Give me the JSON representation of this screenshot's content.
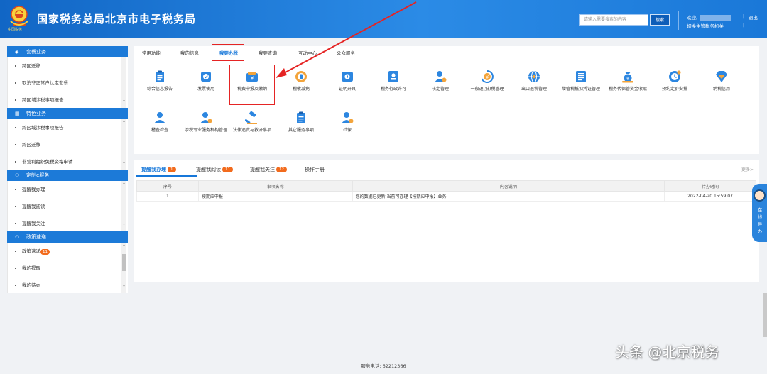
{
  "header": {
    "title": "国家税务总局北京市电子税务局",
    "emblem_caption": "中国税务",
    "search_placeholder": "请输入需要搜索的内容",
    "search_button": "搜索",
    "welcome": "欢迎,",
    "switch_label": "切换主管税务机关",
    "logout": "退出",
    "separator": "|"
  },
  "sidebar": {
    "groups": [
      {
        "title": "套餐业务",
        "icon": "layers-icon",
        "items": [
          "跨区迁移",
          "取消非正常户认定套餐",
          "跨区域涉税事项报告"
        ]
      },
      {
        "title": "特色业务",
        "icon": "grid-icon",
        "items": [
          "跨区域涉税事项报告",
          "跨区迁移",
          "非营利组织免税资格申请"
        ]
      },
      {
        "title": "定制e服务",
        "icon": "user-icon",
        "items": [
          "提醒我办理",
          "提醒我阅读",
          "提醒我关注"
        ]
      },
      {
        "title": "政策速递",
        "icon": "user-icon",
        "items": [
          "政策速递",
          "我的提醒",
          "我的待办"
        ],
        "badge": "11"
      }
    ]
  },
  "top_tabs": [
    "常用功能",
    "我的信息",
    "我要办税",
    "我要查询",
    "互动中心",
    "公众服务"
  ],
  "active_top_tab": "我要办税",
  "functions_row1": [
    {
      "label": "综合信息报告",
      "icon": "clipboard-icon"
    },
    {
      "label": "发票使用",
      "icon": "invoice-icon"
    },
    {
      "label": "税费申报及缴纳",
      "icon": "wallet-yen-icon"
    },
    {
      "label": "税收减免",
      "icon": "coin-icon"
    },
    {
      "label": "证明开具",
      "icon": "certificate-icon"
    },
    {
      "label": "税务行政许可",
      "icon": "badge-icon"
    },
    {
      "label": "核定管理",
      "icon": "user-gear-icon"
    },
    {
      "label": "一般退(抵)税管理",
      "icon": "yen-refresh-icon"
    },
    {
      "label": "出口退税管理",
      "icon": "globe-icon"
    },
    {
      "label": "增值税抵扣凭证管理",
      "icon": "ticket-icon"
    },
    {
      "label": "税务代保管资金收取",
      "icon": "money-bag-icon"
    },
    {
      "label": "预约定价安排",
      "icon": "clock-yen-icon"
    },
    {
      "label": "纳税信用",
      "icon": "diamond-heart-icon"
    }
  ],
  "functions_row2": [
    {
      "label": "稽查检查",
      "icon": "user-icon"
    },
    {
      "label": "涉税专业服务机构管理",
      "icon": "user-check-icon"
    },
    {
      "label": "法律追责与救济事项",
      "icon": "gavel-icon"
    },
    {
      "label": "其它服务事项",
      "icon": "clipboard-icon"
    },
    {
      "label": "社保",
      "icon": "user-shield-icon"
    }
  ],
  "reminder_tabs": [
    {
      "label": "提醒我办理",
      "badge": "1"
    },
    {
      "label": "提醒我阅读",
      "badge": "11"
    },
    {
      "label": "提醒我关注",
      "badge": "12"
    },
    {
      "label": "操作手册",
      "badge": ""
    }
  ],
  "more_link": "更多>",
  "reminder_table": {
    "columns": [
      "序号",
      "事项名称",
      "内容说明",
      "待办时间"
    ],
    "rows": [
      [
        "1",
        "按期应申报",
        "您的数据已更新,当前可办理【按期应申报】业务",
        "2022-04-20 15:59:07"
      ]
    ]
  },
  "float_help": "在线导办",
  "footer": "服务电话: 62212366",
  "watermark": "头条 @北京税务",
  "colors": {
    "brand_blue": "#1c7ad8",
    "highlight_red": "#e52424",
    "badge_orange": "#f26b1d"
  }
}
